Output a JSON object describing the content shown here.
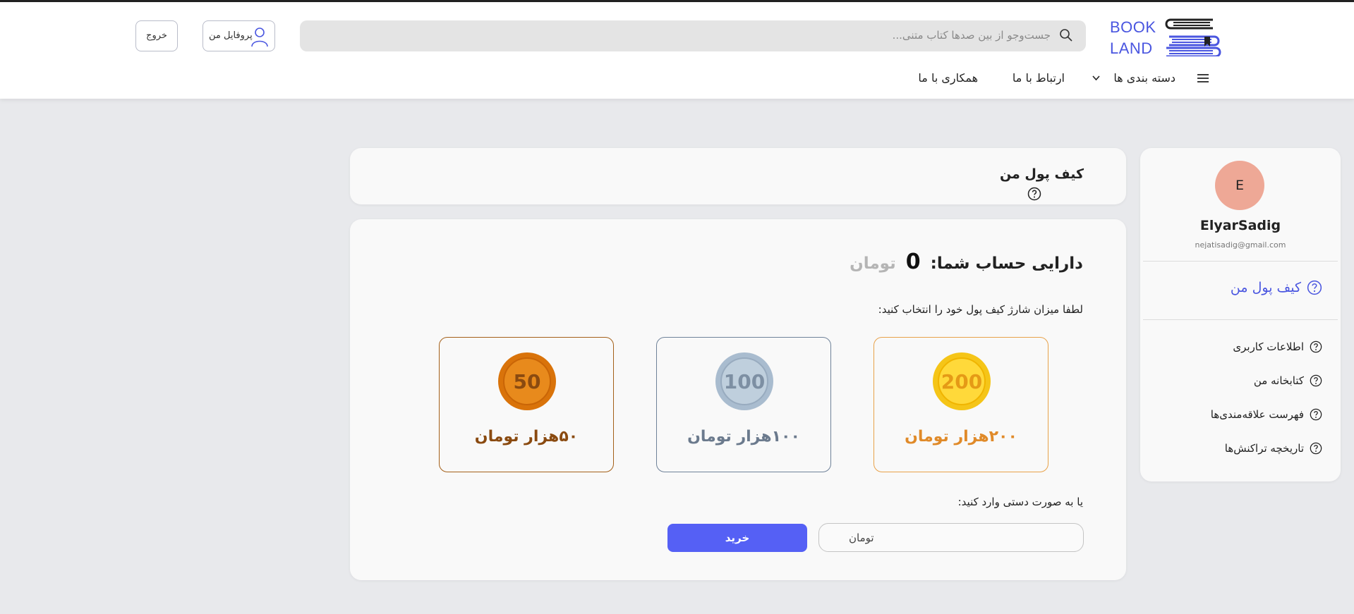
{
  "header": {
    "logo_line1": "BOOK",
    "logo_line2": "LAND",
    "search_placeholder": "جست‌وجو از بین صدها کتاب متنی...",
    "profile_label": "پروفایل من",
    "logout_label": "خروج",
    "nav": {
      "categories": "دسته بندی ها",
      "contact": "ارتباط با ما",
      "cooperate": "همکاری با ما"
    }
  },
  "wallet": {
    "title": "کیف پول من",
    "balance_label": "دارایی حساب شما:",
    "balance_value": "0",
    "currency": "تومان",
    "prompt": "لطفا میزان شارژ کیف پول خود را انتخاب کنید:",
    "packages": [
      {
        "coin": "200",
        "label": "۲۰۰هزار تومان",
        "color": "#f5c518"
      },
      {
        "coin": "100",
        "label": "۱۰۰هزار تومان",
        "color": "#a9bccf"
      },
      {
        "coin": "50",
        "label": "۵۰هزار تومان",
        "color": "#d9730a"
      }
    ],
    "manual_prompt": "یا به صورت دستی وارد کنید:",
    "amount_placeholder": "تومان",
    "buy_label": "خرید"
  },
  "sidebar": {
    "avatar_initial": "E",
    "username": "ElyarSadig",
    "email": "nejatisadig@gmail.com",
    "active_item": "کیف پول من",
    "items": [
      {
        "label": "اطلاعات کاربری"
      },
      {
        "label": "کتابخانه من"
      },
      {
        "label": "فهرست علاقه‌مندی‌ها"
      },
      {
        "label": "تاریخچه تراکنش‌ها"
      }
    ]
  },
  "colors": {
    "accent": "#4a56e0",
    "button": "#5560f5",
    "avatar": "#eea896"
  }
}
